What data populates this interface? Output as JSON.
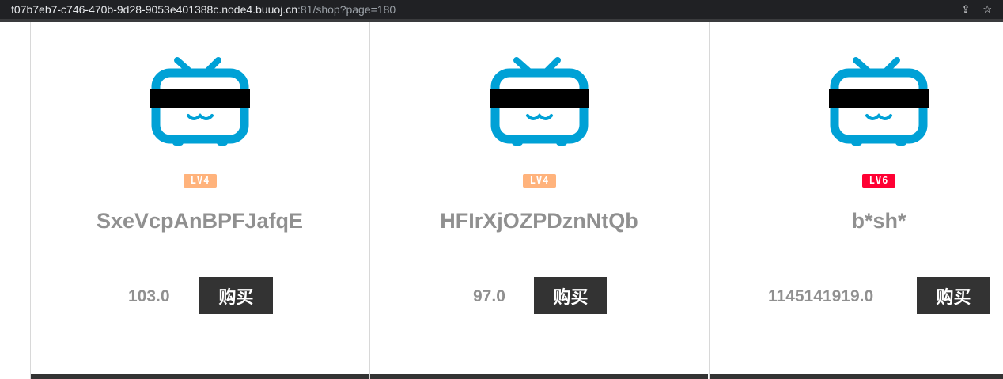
{
  "browser": {
    "url_host": "f07b7eb7-c746-470b-9d28-9053e401388c.node4.buuoj.cn",
    "url_rest": ":81/shop?page=180",
    "share_icon": "share-icon",
    "bookmark_icon": "star-icon"
  },
  "colors": {
    "tv_blue": "#00a1d6",
    "level_orange": "#ffb37c",
    "level_red": "#ff0033",
    "button_bg": "#333333"
  },
  "products": [
    {
      "level": "LV4",
      "level_color": "#ffb37c",
      "name": "SxeVcpAnBPFJafqE",
      "price": "103.0",
      "buy_label": "购买"
    },
    {
      "level": "LV4",
      "level_color": "#ffb37c",
      "name": "HFIrXjOZPDznNtQb",
      "price": "97.0",
      "buy_label": "购买"
    },
    {
      "level": "LV6",
      "level_color": "#ff0033",
      "name": "b*sh*",
      "price": "1145141919.0",
      "buy_label": "购买"
    }
  ]
}
